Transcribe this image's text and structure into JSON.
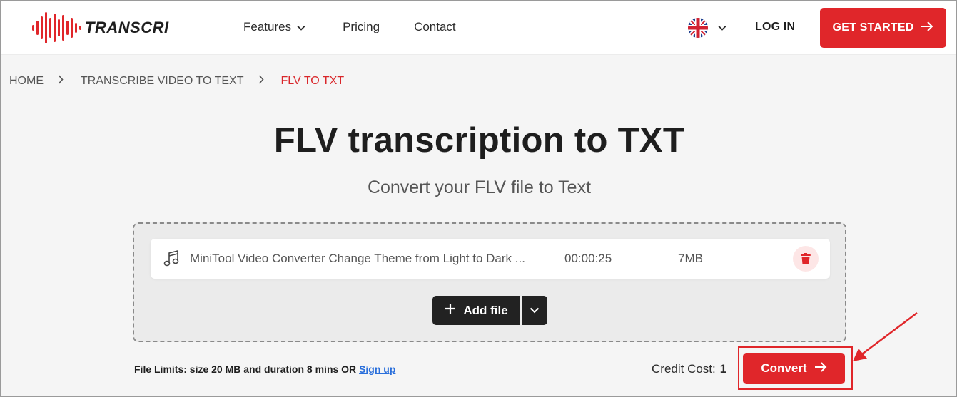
{
  "header": {
    "logo_text": "TRANSCRI",
    "nav": [
      {
        "label": "Features",
        "has_dropdown": true
      },
      {
        "label": "Pricing"
      },
      {
        "label": "Contact"
      }
    ],
    "language_icon": "uk-flag-icon",
    "login_label": "LOG IN",
    "get_started_label": "GET STARTED"
  },
  "breadcrumb": [
    "HOME",
    "TRANSCRIBE VIDEO TO TEXT",
    "FLV TO TXT"
  ],
  "main": {
    "title": "FLV transcription to TXT",
    "subtitle": "Convert your FLV file to Text"
  },
  "file": {
    "name": "MiniTool Video Converter Change Theme from Light to Dark ...",
    "duration": "00:00:25",
    "size": "7MB",
    "icon": "music-note-icon"
  },
  "add_file_label": "Add file",
  "footer": {
    "limits_text": "File Limits: size 20 MB and duration 8 mins OR ",
    "signup_label": "Sign up",
    "credit_label": "Credit Cost:",
    "credit_value": "1",
    "convert_label": "Convert"
  },
  "colors": {
    "accent": "#e0262a",
    "dark_button": "#222222",
    "link": "#2a6fdb"
  }
}
